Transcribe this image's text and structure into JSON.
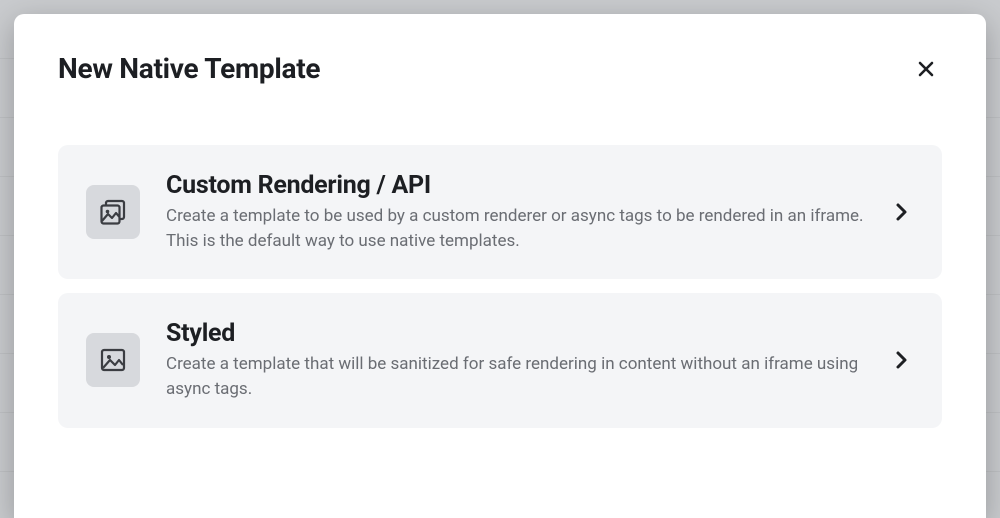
{
  "modal": {
    "title": "New Native Template"
  },
  "options": [
    {
      "icon": "gallery-stack",
      "title": "Custom Rendering / API",
      "description": "Create a template to be used by a custom renderer or async tags to be rendered in an iframe. This is the default way to use native templates."
    },
    {
      "icon": "image",
      "title": "Styled",
      "description": "Create a template that will be sanitized for safe rendering in content without an iframe using async tags."
    }
  ]
}
